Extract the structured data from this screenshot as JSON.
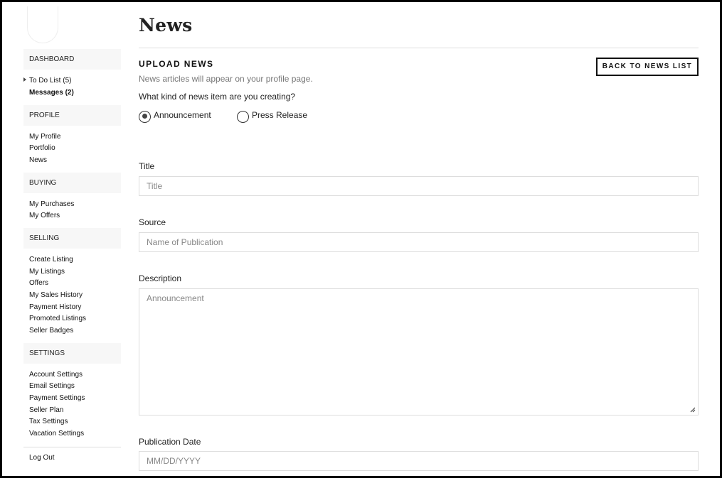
{
  "sidebar": {
    "dashboard_header": "DASHBOARD",
    "todo": "To Do List (5)",
    "messages": "Messages (2)",
    "profile_header": "PROFILE",
    "profile_items": [
      "My Profile",
      "Portfolio",
      "News"
    ],
    "buying_header": "BUYING",
    "buying_items": [
      "My Purchases",
      "My Offers"
    ],
    "selling_header": "SELLING",
    "selling_items": [
      "Create Listing",
      "My Listings",
      "Offers",
      "My Sales History",
      "Payment History",
      "Promoted Listings",
      "Seller Badges"
    ],
    "settings_header": "SETTINGS",
    "settings_items": [
      "Account Settings",
      "Email Settings",
      "Payment Settings",
      "Seller Plan",
      "Tax Settings",
      "Vacation Settings"
    ],
    "logout": "Log Out"
  },
  "main": {
    "page_title": "News",
    "section_title": "UPLOAD NEWS",
    "back_button": "BACK TO NEWS LIST",
    "subtitle": "News articles will appear on your profile page.",
    "question": "What kind of news item are you creating?",
    "radio_options": [
      {
        "label": "Announcement",
        "checked": true
      },
      {
        "label": "Press Release",
        "checked": false
      }
    ],
    "fields": {
      "title": {
        "label": "Title",
        "placeholder": "Title",
        "value": ""
      },
      "source": {
        "label": "Source",
        "placeholder": "Name of Publication",
        "value": ""
      },
      "description": {
        "label": "Description",
        "placeholder": "Announcement",
        "value": ""
      },
      "publication_date": {
        "label": "Publication Date",
        "placeholder": "MM/DD/YYYY",
        "value": ""
      }
    }
  }
}
